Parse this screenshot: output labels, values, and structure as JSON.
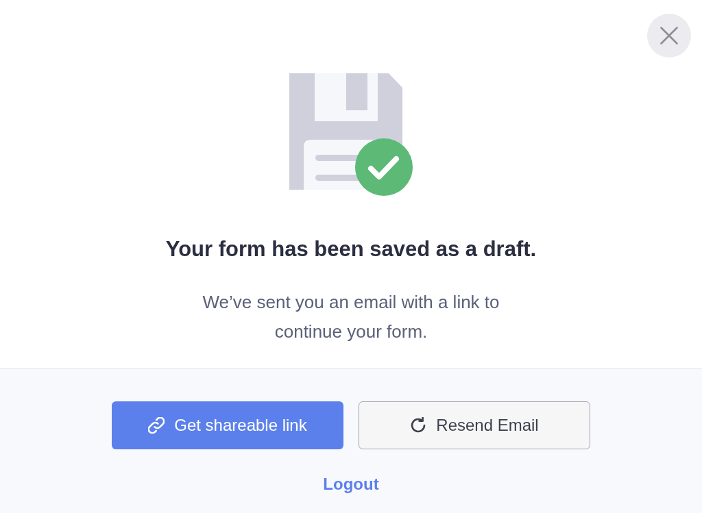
{
  "dialog": {
    "heading": "Your form has been saved as a draft.",
    "message": "We’ve sent you an email with a link to continue your form."
  },
  "actions": [
    {
      "kind": "primary",
      "label": "Get shareable link"
    },
    {
      "kind": "outline",
      "label": "Resend Email"
    }
  ],
  "footer_link": {
    "label": "Logout"
  }
}
